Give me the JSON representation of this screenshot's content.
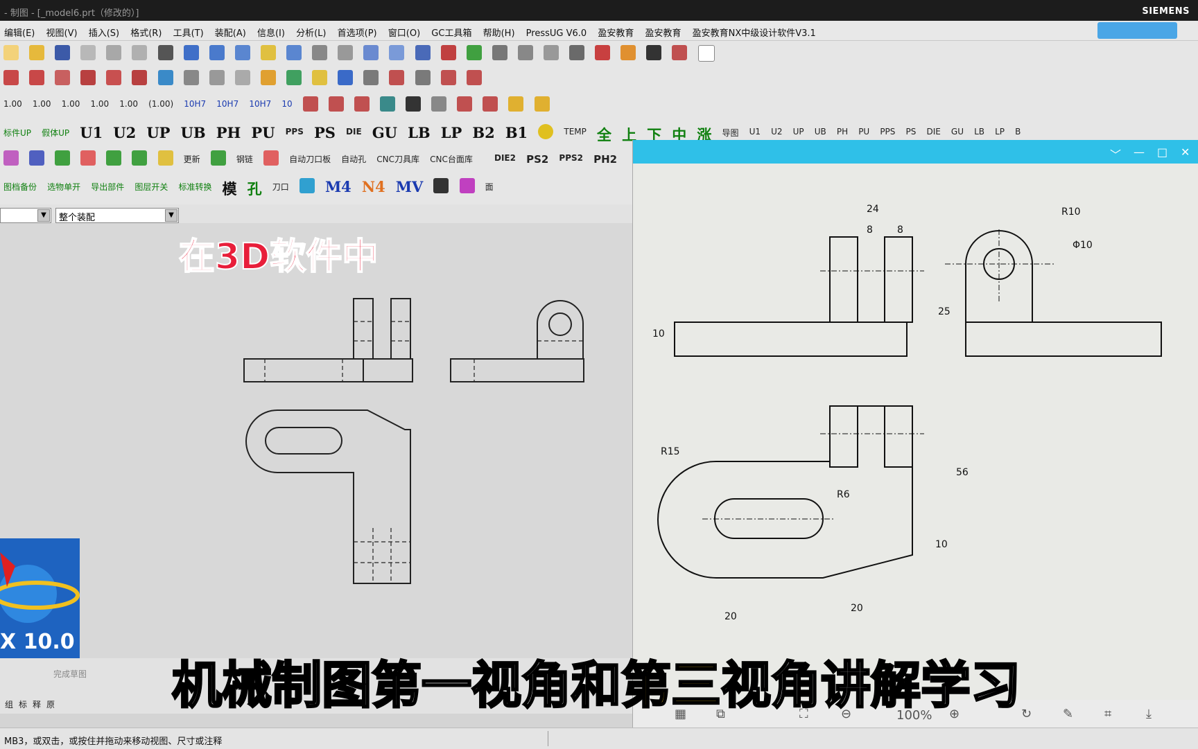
{
  "window": {
    "title": "- 制图 - [_model6.prt（修改的）]",
    "brand": "SIEMENS"
  },
  "menu": [
    "编辑(E)",
    "视图(V)",
    "插入(S)",
    "格式(R)",
    "工具(T)",
    "装配(A)",
    "信息(I)",
    "分析(L)",
    "首选项(P)",
    "窗口(O)",
    "GC工具箱",
    "帮助(H)",
    "PressUG V6.0",
    "盈安教育",
    "盈安教育",
    "盈安教育NX中级设计软件V3.1"
  ],
  "toolbar": {
    "row3_labels": [
      "1.00",
      "1.00",
      "1.00",
      "1.00",
      "1.00",
      "(1.00)",
      "10H7",
      "10H7",
      "10H7",
      "10"
    ],
    "row4_labels": [
      "标件UP",
      "假体UP",
      "U1",
      "U2",
      "UP",
      "UB",
      "PH",
      "PU",
      "PPS",
      "PS",
      "DIE",
      "GU",
      "LB",
      "LP",
      "B2",
      "B1",
      "TEMP",
      "全",
      "上",
      "下",
      "中",
      "涨",
      "导图"
    ],
    "row4_right_labels": [
      "U1",
      "U2",
      "UP",
      "UB",
      "PH",
      "PU",
      "PPS",
      "PS",
      "DIE",
      "GU",
      "LB",
      "LP",
      "B"
    ],
    "row5_labels": [
      "更新",
      "钢链",
      "自动刀口板",
      "自动孔",
      "CNC刀具库",
      "CNC台面库",
      "DIE2",
      "PS2",
      "PPS2",
      "PH2"
    ],
    "row6_labels": [
      "图档备份",
      "选物单开",
      "导出部件",
      "图层开关",
      "标准转换",
      "模",
      "孔",
      "刀口",
      "M4",
      "N4",
      "MV",
      "面"
    ],
    "combo_left": "",
    "combo_assembly": "整个装配"
  },
  "overlay_title": "在3D软件中",
  "nx_version": "X 10.0",
  "bottom_toolbar": {
    "finish_sketch": "完成草图",
    "row_labels": [
      "组",
      "标",
      "释",
      "原"
    ]
  },
  "viewer": {
    "zoom": "100%",
    "dims": {
      "top_width": "24",
      "slot_a": "8",
      "slot_b": "8",
      "r10": "R10",
      "phi10": "Φ10",
      "h25": "25",
      "h10_left": "10",
      "r15": "R15",
      "r6": "R6",
      "h56": "56",
      "h10_right": "10",
      "w20_left": "20",
      "w20_right": "20"
    }
  },
  "caption": {
    "part1": "机械制图第一视角和",
    "part2": "第三",
    "part3": "视角讲解学习"
  },
  "status": "MB3，或双击，或按住并拖动来移动视图、尺寸或注释"
}
